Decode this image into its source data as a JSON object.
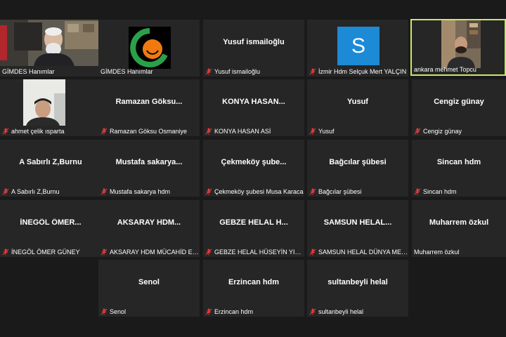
{
  "colors": {
    "background": "#1a1a1a",
    "tile": "#262626",
    "active_border": "#c9e86a",
    "mute_icon": "#e03c3c",
    "avatar_blue": "#1d8ad6"
  },
  "tiles": [
    {
      "name": "",
      "caption": "GİMDES Hanımlar",
      "muted": false,
      "kind": "video"
    },
    {
      "name": "",
      "caption": "GİMDES Hanımlar",
      "muted": false,
      "kind": "logo"
    },
    {
      "name": "Yusuf ismailoğlu",
      "caption": "Yusuf ismailoğlu",
      "muted": true,
      "kind": "name"
    },
    {
      "name": "",
      "caption": "İzmir Hdm Selçuk Mert YALÇIN",
      "muted": true,
      "kind": "avatar",
      "avatar_letter": "S"
    },
    {
      "name": "",
      "caption": "ankara mehmet Topcu",
      "muted": false,
      "kind": "video",
      "active": true
    },
    {
      "name": "",
      "caption": "ahmet çelik ısparta",
      "muted": true,
      "kind": "video"
    },
    {
      "name": "Ramazan  Göksu...",
      "caption": "Ramazan Göksu Osmaniye",
      "muted": true,
      "kind": "name"
    },
    {
      "name": "KONYA  HASAN...",
      "caption": "KONYA HASAN ASİ",
      "muted": true,
      "kind": "name"
    },
    {
      "name": "Yusuf",
      "caption": "Yusuf",
      "muted": true,
      "kind": "name"
    },
    {
      "name": "Cengiz günay",
      "caption": "Cengiz günay",
      "muted": true,
      "kind": "name"
    },
    {
      "name": "A Sabırlı Z,Burnu",
      "caption": "A Sabırlı Z,Burnu",
      "muted": true,
      "kind": "name"
    },
    {
      "name": "Mustafa  sakarya...",
      "caption": "Mustafa sakarya hdm",
      "muted": true,
      "kind": "name"
    },
    {
      "name": "Çekmeköy  şube...",
      "caption": "Çekmeköy şubesi Musa Karaca",
      "muted": true,
      "kind": "name"
    },
    {
      "name": "Bağcılar şübesi",
      "caption": "Bağcılar şübesi",
      "muted": true,
      "kind": "name"
    },
    {
      "name": "Sincan hdm",
      "caption": "Sincan hdm",
      "muted": true,
      "kind": "name"
    },
    {
      "name": "İNEGÖL  ÖMER...",
      "caption": "İNEGÖL ÖMER GÜNEY",
      "muted": true,
      "kind": "name"
    },
    {
      "name": "AKSARAY  HDM...",
      "caption": "AKSARAY HDM MÜCAHİD ERGİN",
      "muted": true,
      "kind": "name"
    },
    {
      "name": "GEBZE HELAL  H...",
      "caption": "GEBZE HELAL HÜSEYİN YILMAZ",
      "muted": true,
      "kind": "name"
    },
    {
      "name": "SAMSUN  HELAL...",
      "caption": "SAMSUN HELAL DÜNYA MEHMET",
      "muted": true,
      "kind": "name"
    },
    {
      "name": "Muharrem özkul",
      "caption": "Muharrem özkul",
      "muted": false,
      "kind": "name"
    },
    {
      "name": "Senol",
      "caption": "Senol",
      "muted": true,
      "kind": "name"
    },
    {
      "name": "Erzincan hdm",
      "caption": "Erzincan hdm",
      "muted": true,
      "kind": "name"
    },
    {
      "name": "sultanbeyli helal",
      "caption": "sultanbeyli helal",
      "muted": true,
      "kind": "name"
    }
  ]
}
